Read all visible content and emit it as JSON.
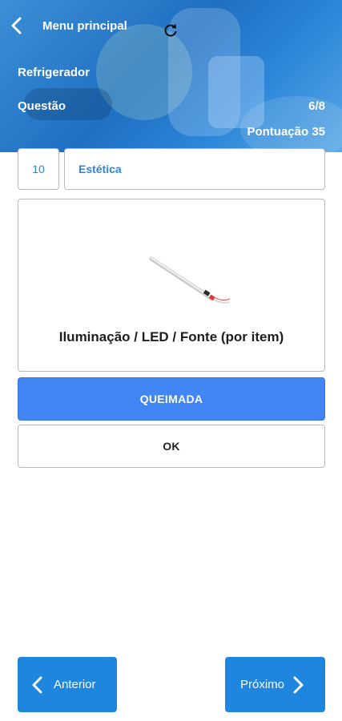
{
  "header": {
    "back_icon": "chevron-left-icon",
    "menu_label": "Menu principal",
    "refresh_icon": "refresh-icon",
    "appliance": "Refrigerador",
    "question_label": "Questão",
    "question_progress": "6/8",
    "score_label": "Pontuação 35"
  },
  "question": {
    "number": "10",
    "category": "Estética",
    "item_name": "Iluminação / LED / Fonte (por item)"
  },
  "options": [
    {
      "label": "QUEIMADA",
      "selected": true
    },
    {
      "label": "OK",
      "selected": false
    }
  ],
  "navigation": {
    "previous_label": "Anterior",
    "next_label": "Próximo"
  },
  "colors": {
    "accent": "#2d86de",
    "selected_option": "#4285f4",
    "nav_button": "#1f86e0"
  }
}
